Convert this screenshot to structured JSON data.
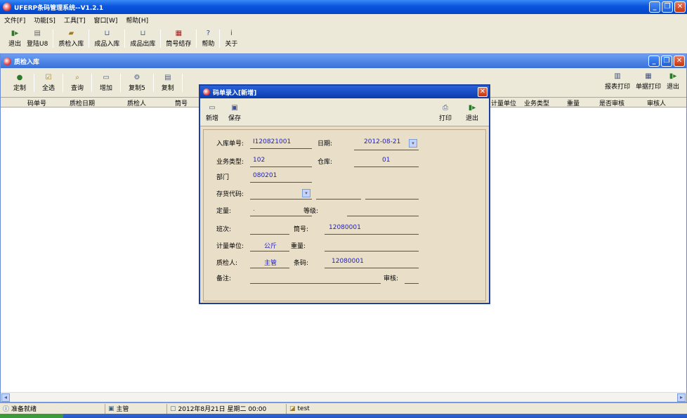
{
  "app": {
    "title": "UFERP条码管理系统--V1.2.1"
  },
  "menu": [
    "文件[F]",
    "功能[S]",
    "工具[T]",
    "窗口[W]",
    "帮助[H]"
  ],
  "main_toolbar": [
    "退出",
    "登陆U8",
    "质检入库",
    "成品入库",
    "成品出库",
    "筒号结存",
    "帮助",
    "关于"
  ],
  "child": {
    "title": "质检入库",
    "toolbar": [
      "定制",
      "全选",
      "查询",
      "增加",
      "复制5",
      "复制"
    ],
    "toolbar_right": [
      "报表打印",
      "单据打印",
      "退出"
    ],
    "columns": [
      "码单号",
      "质检日期",
      "质检人",
      "筒号",
      "计量单位",
      "业务类型",
      "重量",
      "是否审核",
      "审核人"
    ]
  },
  "dialog": {
    "title": "码单录入[新增]",
    "toolbar": {
      "new": "新增",
      "save": "保存",
      "print": "打印",
      "exit": "退出"
    },
    "fields": {
      "inbound_no_label": "入库单号:",
      "inbound_no": "I120821001",
      "date_label": "日期:",
      "date": "2012-08-21",
      "biz_type_label": "业务类型:",
      "biz_type": "102",
      "warehouse_label": "仓库:",
      "warehouse": "01",
      "dept_label": "部门",
      "dept": "080201",
      "inv_code_label": "存货代码:",
      "fixed_label": "定量:",
      "fixed": ".",
      "grade_label": "等级:",
      "shift_label": "班次:",
      "tube_label": "筒号:",
      "tube": "12080001",
      "unit_label": "计量单位:",
      "unit": "公斤",
      "weight_label": "重量:",
      "inspector_label": "质检人:",
      "inspector": "主管",
      "barcode_label": "条码:",
      "barcode": "12080001",
      "remark_label": "备注:",
      "audit_label": "审核:"
    }
  },
  "status": {
    "ready": "准备就绪",
    "user": "主管",
    "datetime": "2012年8月21日  星期二  00:00",
    "db": "test"
  }
}
